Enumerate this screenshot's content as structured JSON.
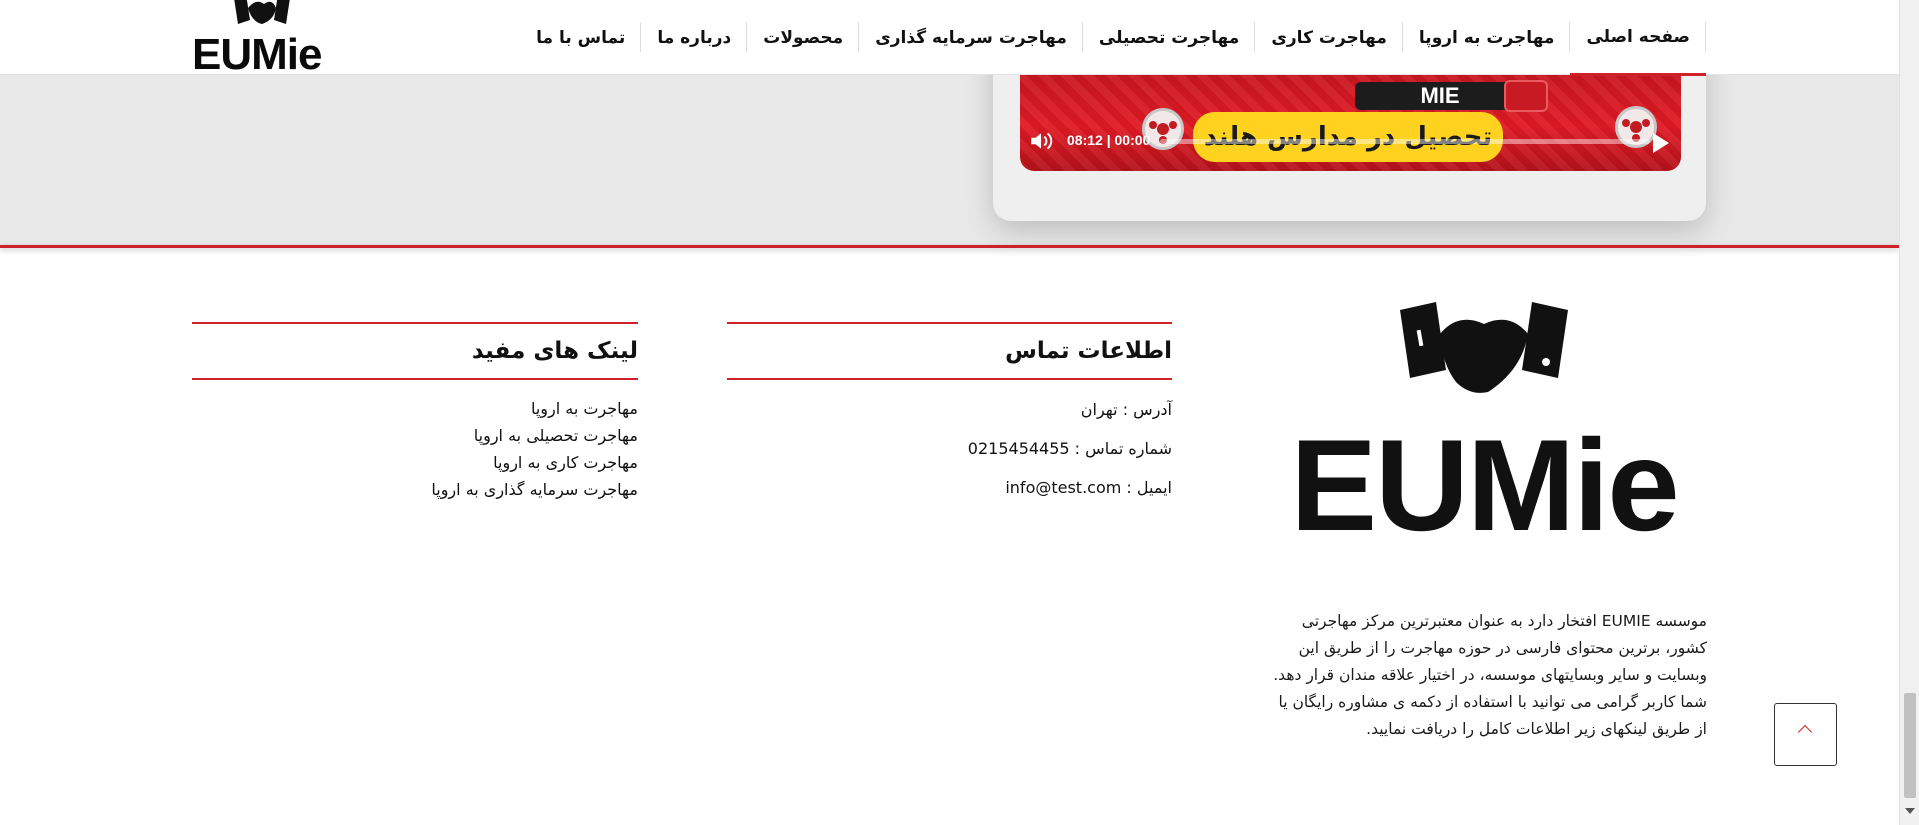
{
  "header": {
    "logo_text": "EUMie",
    "nav": [
      {
        "label": "صفحه اصلی",
        "active": true
      },
      {
        "label": "مهاجرت به اروپا",
        "active": false
      },
      {
        "label": "مهاجرت کاری",
        "active": false
      },
      {
        "label": "مهاجرت تحصیلی",
        "active": false
      },
      {
        "label": "مهاجرت سرمایه گذاری",
        "active": false
      },
      {
        "label": "محصولات",
        "active": false
      },
      {
        "label": "درباره ما",
        "active": false
      },
      {
        "label": "تماس با ما",
        "active": false
      }
    ]
  },
  "video": {
    "tag": "MIE",
    "title": "تحصیل در مدارس هلند",
    "time": "08:12 | 00:00"
  },
  "footer": {
    "logo_text": "EUMie",
    "about": "موسسه EUMIE افتخار دارد به عنوان معتبرترین مرکز مهاجرتی کشور، برترین محتوای فارسی در حوزه مهاجرت را از طریق این وبسایت و سایر وبسایتهای موسسه، در اختیار علاقه مندان قرار دهد. شما کاربر گرامی می توانید با استفاده از دکمه ی مشاوره رایگان یا از طریق لینکهای زیر اطلاعات کامل را دریافت نمایید.",
    "contact": {
      "heading": "اطلاعات تماس",
      "address": "آدرس : تهران",
      "phone": "شماره تماس : 0215454455",
      "email": "ایمیل : info@test.com"
    },
    "links": {
      "heading": "لینک های مفید",
      "items": [
        "مهاجرت به اروپا",
        "مهاجرت تحصیلی به اروپا",
        "مهاجرت کاری به اروپا",
        "مهاجرت سرمایه گذاری به اروپا"
      ]
    }
  },
  "colors": {
    "accent": "#d0202a",
    "video_bg": "#e01a24",
    "video_title_bg": "#ffd21f"
  }
}
